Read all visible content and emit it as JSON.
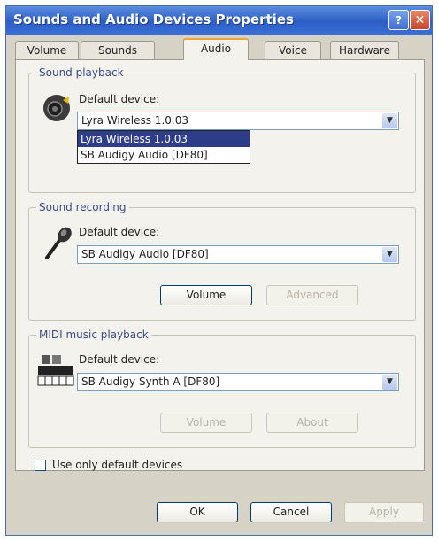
{
  "window": {
    "title": "Sounds and Audio Devices Properties"
  },
  "titlebar": {
    "help_label": "?",
    "close_label": "✕"
  },
  "tabs": [
    {
      "label": "Volume"
    },
    {
      "label": "Sounds"
    },
    {
      "label": "Audio"
    },
    {
      "label": "Voice"
    },
    {
      "label": "Hardware"
    }
  ],
  "playback": {
    "legend": "Sound playback",
    "device_label": "Default device:",
    "selected": "Lyra Wireless 1.0.03",
    "options": [
      "Lyra Wireless 1.0.03",
      "SB Audigy Audio [DF80]"
    ],
    "icon": "speaker-icon"
  },
  "recording": {
    "legend": "Sound recording",
    "device_label": "Default device:",
    "selected": "SB Audigy Audio [DF80]",
    "volume_label": "Volume",
    "advanced_label": "Advanced",
    "icon": "microphone-icon"
  },
  "midi": {
    "legend": "MIDI music playback",
    "device_label": "Default device:",
    "selected": "SB Audigy Synth A [DF80]",
    "volume_label": "Volume",
    "about_label": "About",
    "icon": "midi-keyboard-icon"
  },
  "checkbox": {
    "label": "Use only default devices",
    "checked": false
  },
  "footer": {
    "ok_label": "OK",
    "cancel_label": "Cancel",
    "apply_label": "Apply"
  },
  "colors": {
    "title_bar": "#2d5fc4",
    "selection": "#2d3d8a",
    "active_tab_accent": "#e7a53a"
  }
}
